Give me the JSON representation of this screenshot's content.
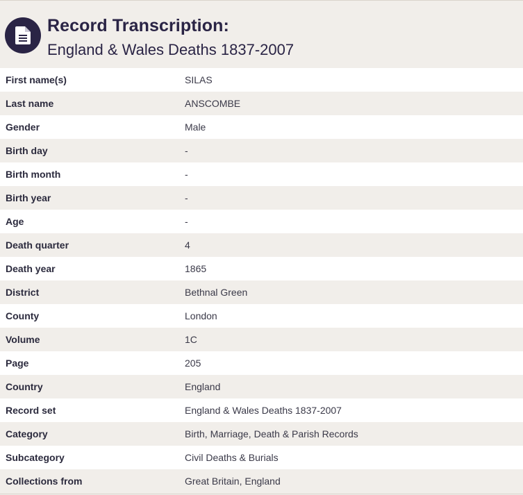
{
  "header": {
    "icon": "document-icon",
    "title": "Record Transcription:",
    "subtitle": "England & Wales Deaths 1837-2007"
  },
  "colors": {
    "brand": "#2a2445",
    "row_alt": "#f1eeea",
    "row": "#ffffff"
  },
  "record": {
    "rows": [
      {
        "label": "First name(s)",
        "value": "SILAS"
      },
      {
        "label": "Last name",
        "value": "ANSCOMBE"
      },
      {
        "label": "Gender",
        "value": "Male"
      },
      {
        "label": "Birth day",
        "value": "-"
      },
      {
        "label": "Birth month",
        "value": "-"
      },
      {
        "label": "Birth year",
        "value": "-"
      },
      {
        "label": "Age",
        "value": "-"
      },
      {
        "label": "Death quarter",
        "value": "4"
      },
      {
        "label": "Death year",
        "value": "1865"
      },
      {
        "label": "District",
        "value": "Bethnal Green"
      },
      {
        "label": "County",
        "value": "London"
      },
      {
        "label": "Volume",
        "value": "1C"
      },
      {
        "label": "Page",
        "value": "205"
      },
      {
        "label": "Country",
        "value": "England"
      },
      {
        "label": "Record set",
        "value": "England & Wales Deaths 1837-2007"
      },
      {
        "label": "Category",
        "value": "Birth, Marriage, Death & Parish Records"
      },
      {
        "label": "Subcategory",
        "value": "Civil Deaths & Burials"
      },
      {
        "label": "Collections from",
        "value": "Great Britain, England"
      }
    ]
  }
}
